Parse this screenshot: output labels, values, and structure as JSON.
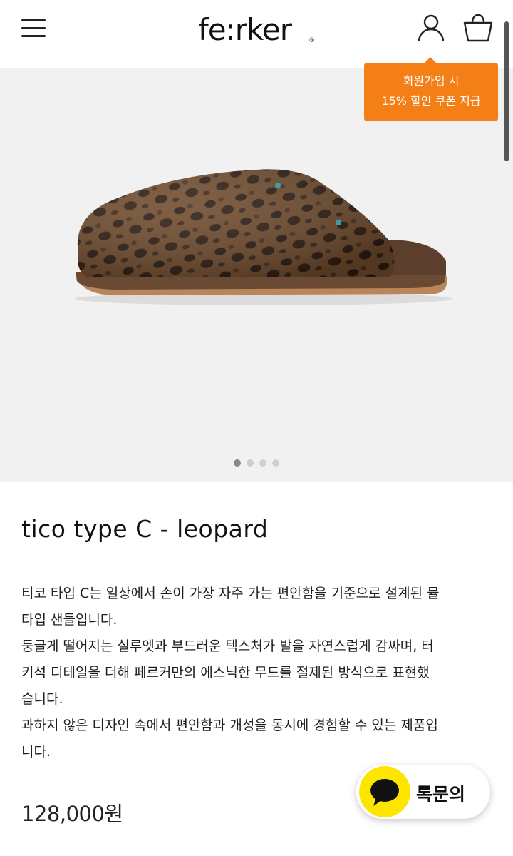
{
  "header": {
    "logo_text": "fe:rker",
    "logo_mark": "®",
    "icons": {
      "menu": "hamburger-menu-icon",
      "user": "user-icon",
      "cart": "shopping-bag-icon"
    }
  },
  "promo": {
    "line1": "회원가입 시",
    "line2": "15% 할인 쿠폰 지급",
    "color": "#f57f17"
  },
  "gallery": {
    "image": "leopard-fur-slipper",
    "slide_count": 4,
    "active_slide": 1
  },
  "product": {
    "title": "tico type C - leopard",
    "description": [
      "티코 타입 C는 일상에서 손이 가장 자주 가는 편안함을 기준으로 설계된 뮬",
      "타입 샌들입니다.",
      "둥글게 떨어지는 실루엣과 부드러운 텍스처가 발을 자연스럽게 감싸며, 터",
      "키석 디테일을 더해 페르커만의 에스닉한 무드를 절제된 방식으로 표현했",
      "습니다.",
      "과하지 않은 디자인 속에서 편안함과 개성을 동시에 경험할 수 있는 제품입",
      "니다."
    ],
    "price": "128,000원"
  },
  "kakao_chat": {
    "label": "톡문의",
    "icon": "kakao-chat-bubble-icon",
    "color": "#fee500"
  }
}
